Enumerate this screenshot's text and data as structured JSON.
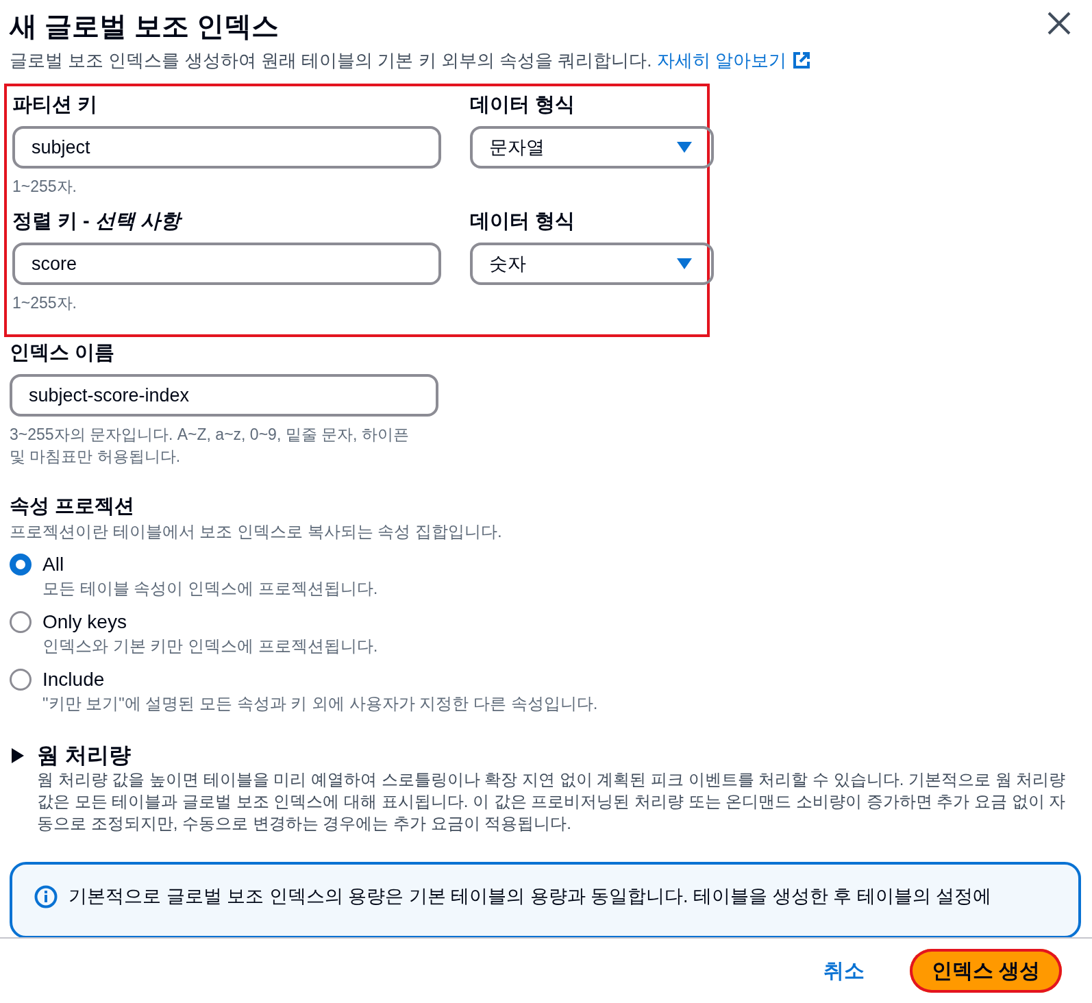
{
  "dialog": {
    "title": "새 글로벌 보조 인덱스",
    "description": "글로벌 보조 인덱스를 생성하여 원래 테이블의 기본 키 외부의 속성을 쿼리합니다.",
    "learn_more": "자세히 알아보기"
  },
  "keys": {
    "highlighted": true,
    "rows": [
      {
        "label": "파티션 키",
        "label_optional": "",
        "value": "subject",
        "hint": "1~255자.",
        "type_label": "데이터 형식",
        "type_value": "문자열"
      },
      {
        "label": "정렬 키 - ",
        "label_optional": "선택 사항",
        "value": "score",
        "hint": "1~255자.",
        "type_label": "데이터 형식",
        "type_value": "숫자"
      }
    ]
  },
  "index_name": {
    "label": "인덱스 이름",
    "value": "subject-score-index",
    "hint": "3~255자의 문자입니다. A~Z, a~z, 0~9, 밑줄 문자, 하이픈 및 마침표만 허용됩니다."
  },
  "projection": {
    "title": "속성 프로젝션",
    "description": "프로젝션이란 테이블에서 보조 인덱스로 복사되는 속성 집합입니다.",
    "options": [
      {
        "label": "All",
        "description": "모든 테이블 속성이 인덱스에 프로젝션됩니다.",
        "selected": true
      },
      {
        "label": "Only keys",
        "description": "인덱스와 기본 키만 인덱스에 프로젝션됩니다.",
        "selected": false
      },
      {
        "label": "Include",
        "description": "\"키만 보기\"에 설명된 모든 속성과 키 외에 사용자가 지정한 다른 속성입니다.",
        "selected": false
      }
    ]
  },
  "warm_throughput": {
    "title": "웜 처리량",
    "expanded": false,
    "description": "웜 처리량 값을 높이면 테이블을 미리 예열하여 스로틀링이나 확장 지연 없이 계획된 피크 이벤트를 처리할 수 있습니다. 기본적으로 웜 처리량 값은 모든 테이블과 글로벌 보조 인덱스에 대해 표시됩니다. 이 값은 프로비저닝된 처리량 또는 온디맨드 소비량이 증가하면 추가 요금 없이 자동으로 조정되지만, 수동으로 변경하는 경우에는 추가 요금이 적용됩니다."
  },
  "info_alert": {
    "text": "기본적으로 글로벌 보조 인덱스의 용량은 기본 테이블의 용량과 동일합니다. 테이블을 생성한 후 테이블의 설정에"
  },
  "footer": {
    "cancel": "취소",
    "create": "인덱스 생성",
    "create_highlighted": true
  }
}
